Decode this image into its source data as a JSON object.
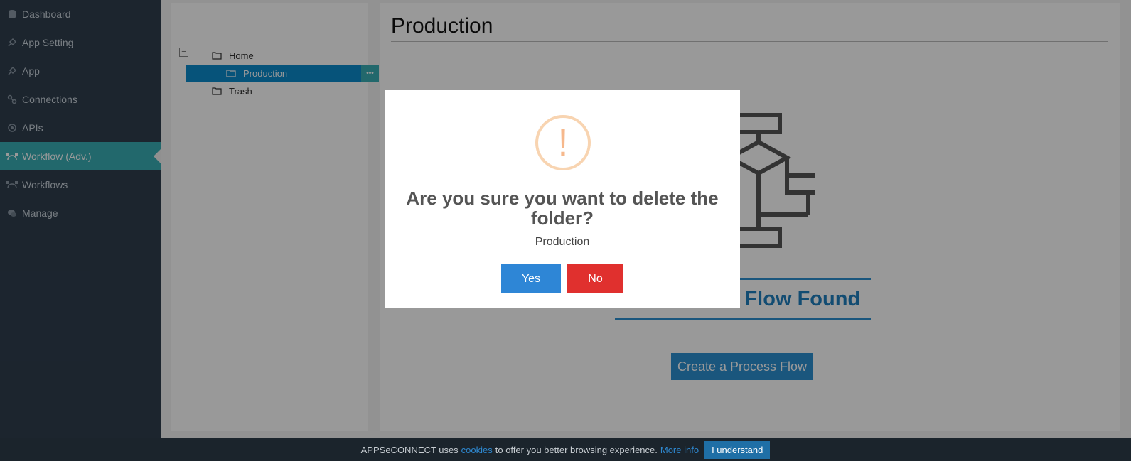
{
  "sidebar": {
    "items": [
      {
        "label": "Dashboard",
        "icon": "database-icon"
      },
      {
        "label": "App Setting",
        "icon": "plug-icon"
      },
      {
        "label": "App",
        "icon": "plug-icon"
      },
      {
        "label": "Connections",
        "icon": "link-icon"
      },
      {
        "label": "APIs",
        "icon": "gear-icon"
      },
      {
        "label": "Workflow (Adv.)",
        "icon": "workflow-icon",
        "active": true
      },
      {
        "label": "Workflows",
        "icon": "workflow-icon"
      },
      {
        "label": "Manage",
        "icon": "chat-icon"
      }
    ]
  },
  "tree": {
    "expander": "−",
    "items": [
      {
        "label": "Home"
      },
      {
        "label": "Production",
        "selected": true
      },
      {
        "label": "Trash"
      }
    ],
    "more_label": "•••"
  },
  "content": {
    "title": "Production",
    "empty_heading": "No Process Flow Found",
    "create_button": "Create a Process Flow"
  },
  "modal": {
    "icon_glyph": "!",
    "title": "Are you sure you want to delete the folder?",
    "text": "Production",
    "yes": "Yes",
    "no": "No"
  },
  "cookie": {
    "text_before": "APPSeCONNECT uses",
    "link_cookies": "cookies",
    "text_after": "to offer you better browsing experience.",
    "link_more": "More info",
    "button": "I understand"
  },
  "colors": {
    "sidebar": "#2f3e4e",
    "accent": "#3aaeb5",
    "primary": "#2c8fd0",
    "danger": "#e0302e"
  }
}
